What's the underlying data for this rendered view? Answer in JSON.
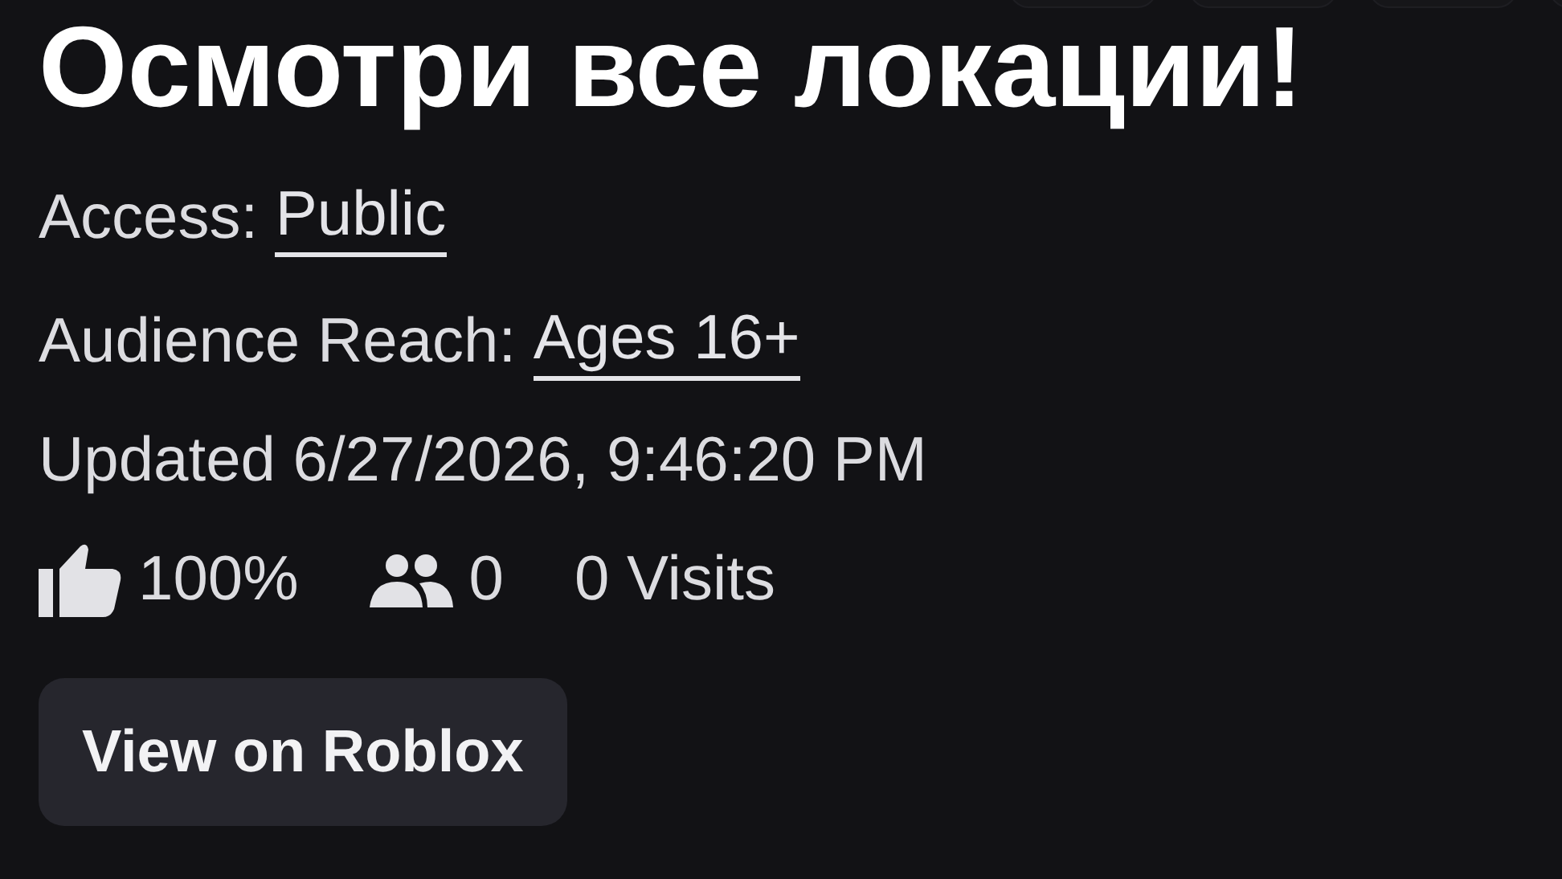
{
  "title": "Осмотри все локации!",
  "details": [
    {
      "label": "Access: ",
      "value": "Public"
    },
    {
      "label": "Audience Reach: ",
      "value": "Ages 16+"
    }
  ],
  "updated": "Updated 6/27/2026, 9:46:20 PM",
  "stats": {
    "rating": "100%",
    "players": "0",
    "visits": "0 Visits"
  },
  "button": "View on Roblox"
}
